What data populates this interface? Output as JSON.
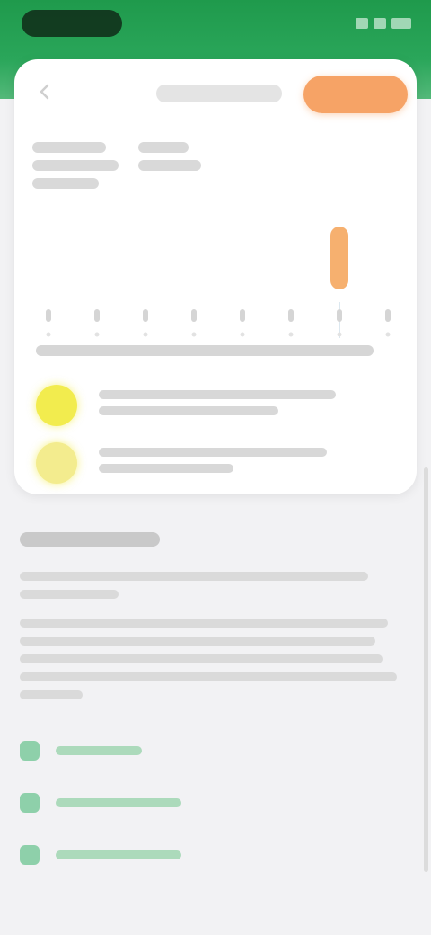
{
  "app": {
    "accent_color": "#2aa65a",
    "cta_color": "#f6a366",
    "highlight_color": "#f2ec4e"
  },
  "status_bar": {
    "icons": [
      "signal-icon",
      "wifi-icon",
      "battery-icon"
    ]
  },
  "header": {
    "back_icon": "back-arrow-icon",
    "title": "",
    "cta_label": ""
  },
  "stats": {
    "primary": "",
    "secondary": ""
  },
  "chart": {
    "selected_index": 6,
    "bar_count": 8
  },
  "tips": [
    {
      "icon": "sun-icon",
      "text": ""
    },
    {
      "icon": "sun-icon",
      "text": ""
    }
  ],
  "section": {
    "title": "",
    "paragraphs": [
      "",
      ""
    ]
  },
  "links": [
    {
      "icon": "document-icon",
      "label": ""
    },
    {
      "icon": "document-icon",
      "label": ""
    },
    {
      "icon": "document-icon",
      "label": ""
    }
  ]
}
